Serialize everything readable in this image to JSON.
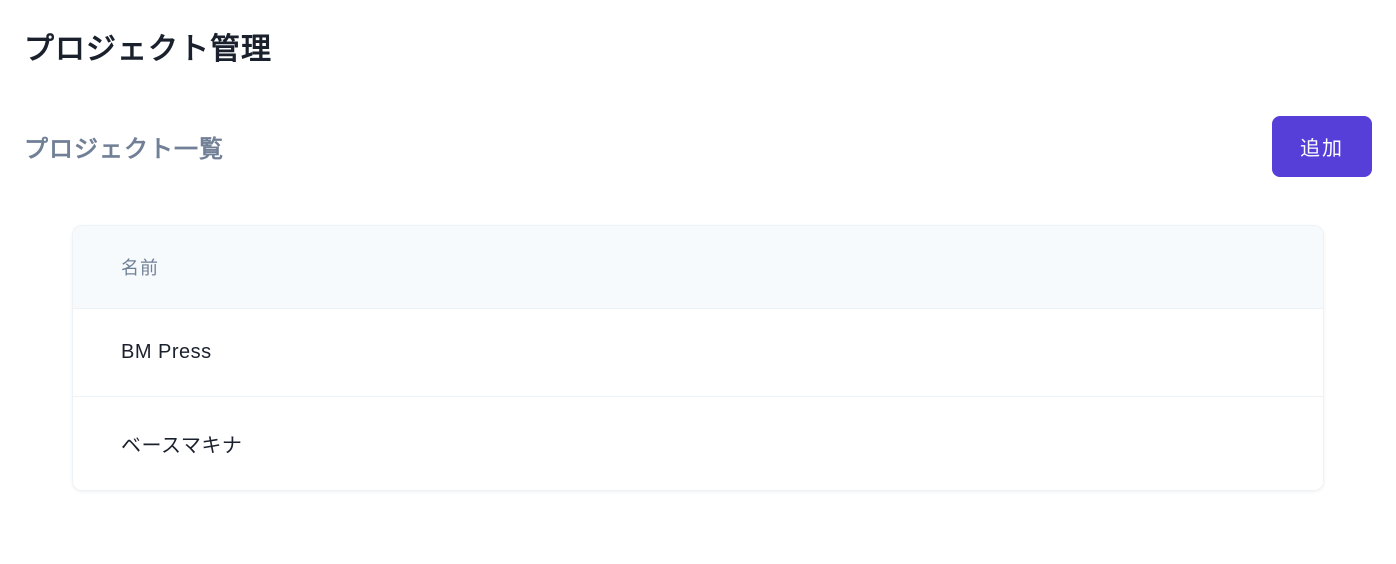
{
  "page": {
    "title": "プロジェクト管理"
  },
  "section": {
    "title": "プロジェクト一覧",
    "add_button_label": "追加"
  },
  "table": {
    "header": {
      "name": "名前"
    },
    "rows": [
      {
        "name": "BM Press"
      },
      {
        "name": "ベースマキナ"
      }
    ]
  }
}
